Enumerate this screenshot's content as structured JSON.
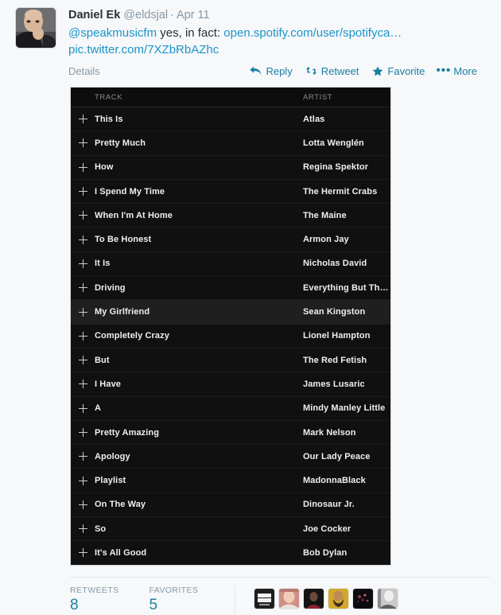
{
  "tweet": {
    "author_name": "Daniel Ek",
    "author_handle": "@eldsjal",
    "separator": "·",
    "timestamp": "Apr 11",
    "mention": "@speakmusicfm",
    "body_text": " yes, in fact: ",
    "link_spotify": "open.spotify.com/user/spotifyca…",
    "link_pic": "pic.twitter.com/7XZbRbAZhc",
    "details_label": "Details",
    "actions": [
      {
        "label": "Reply",
        "icon": "reply-arrow-icon"
      },
      {
        "label": "Retweet",
        "icon": "retweet-icon"
      },
      {
        "label": "Favorite",
        "icon": "star-icon"
      },
      {
        "label": "More",
        "icon": "ellipsis-icon"
      }
    ]
  },
  "playlist": {
    "columns": {
      "plus": "",
      "track": "TRACK",
      "artist": "ARTIST"
    },
    "add_icon": "plus-icon",
    "rows": [
      {
        "track": "This Is",
        "artist": "Atlas",
        "hovered": false
      },
      {
        "track": "Pretty Much",
        "artist": "Lotta Wenglén",
        "hovered": false
      },
      {
        "track": "How",
        "artist": "Regina Spektor",
        "hovered": false
      },
      {
        "track": "I Spend My Time",
        "artist": "The Hermit Crabs",
        "hovered": false
      },
      {
        "track": "When I'm At Home",
        "artist": "The Maine",
        "hovered": false
      },
      {
        "track": "To Be Honest",
        "artist": "Armon Jay",
        "hovered": false
      },
      {
        "track": "It Is",
        "artist": "Nicholas David",
        "hovered": false
      },
      {
        "track": "Driving",
        "artist": "Everything But The…",
        "hovered": false
      },
      {
        "track": "My Girlfriend",
        "artist": "Sean Kingston",
        "hovered": true
      },
      {
        "track": "Completely Crazy",
        "artist": "Lionel Hampton",
        "hovered": false
      },
      {
        "track": "But",
        "artist": "The Red Fetish",
        "hovered": false
      },
      {
        "track": "I Have",
        "artist": "James Lusaric",
        "hovered": false
      },
      {
        "track": "A",
        "artist": "Mindy Manley Little",
        "hovered": false
      },
      {
        "track": "Pretty Amazing",
        "artist": "Mark Nelson",
        "hovered": false
      },
      {
        "track": "Apology",
        "artist": "Our Lady Peace",
        "hovered": false
      },
      {
        "track": "Playlist",
        "artist": "MadonnaBlack",
        "hovered": false
      },
      {
        "track": "On The Way",
        "artist": "Dinosaur Jr.",
        "hovered": false
      },
      {
        "track": "So",
        "artist": "Joe Cocker",
        "hovered": false
      },
      {
        "track": "It's All Good",
        "artist": "Bob Dylan",
        "hovered": false
      }
    ]
  },
  "stats": {
    "retweets_label": "RETWEETS",
    "retweets_value": "8",
    "favorites_label": "FAVORITES",
    "favorites_value": "5",
    "faces": [
      {
        "name": "avatar-speak-music-logo",
        "text": "#SPEAK MUSIC"
      },
      {
        "name": "avatar-child-portrait",
        "text": ""
      },
      {
        "name": "avatar-dark-portrait",
        "text": ""
      },
      {
        "name": "avatar-bearded-man",
        "text": ""
      },
      {
        "name": "avatar-dark-crowd",
        "text": ""
      },
      {
        "name": "avatar-grayscale-portrait",
        "text": ""
      }
    ]
  },
  "colors": {
    "page_bg": "#f6f8fa",
    "link": "#1b95c9",
    "action": "#1b7ea3",
    "muted": "#8899a6",
    "card_bg": "#0d0d0d",
    "row_bg": "#101010",
    "row_hover_bg": "#1f1f1f"
  }
}
